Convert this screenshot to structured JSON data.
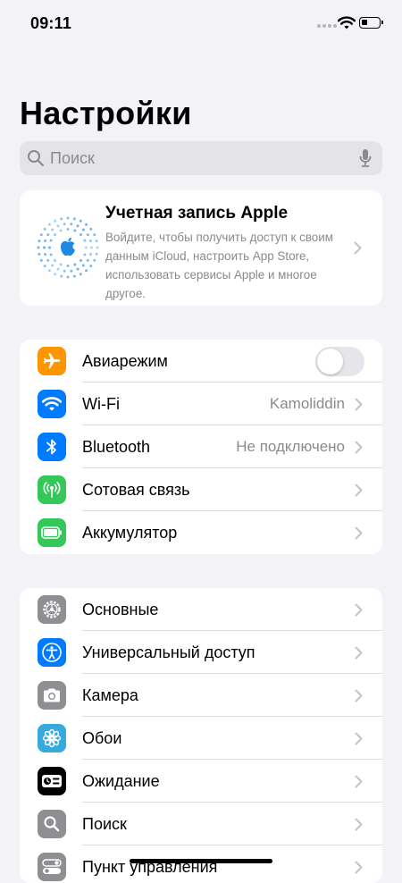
{
  "status_bar": {
    "time": "09:11",
    "battery_level_percent": 35
  },
  "header": {
    "title": "Настройки"
  },
  "search": {
    "placeholder": "Поиск"
  },
  "account": {
    "title": "Учетная запись Apple",
    "description": "Войдите, чтобы получить доступ к своим данным iCloud, настроить App Store, использовать сервисы Apple и многое другое."
  },
  "group1": [
    {
      "label": "Авиарежим",
      "icon": "airplane-icon",
      "color": "#ff9500",
      "toggle": false
    },
    {
      "label": "Wi-Fi",
      "value": "Kamoliddin",
      "icon": "wifi-icon",
      "color": "#007aff"
    },
    {
      "label": "Bluetooth",
      "value": "Не подключено",
      "icon": "bluetooth-icon",
      "color": "#007aff"
    },
    {
      "label": "Сотовая связь",
      "icon": "cellular-icon",
      "color": "#34c759"
    },
    {
      "label": "Аккумулятор",
      "icon": "battery-icon",
      "color": "#34c759"
    }
  ],
  "group2": [
    {
      "label": "Основные",
      "icon": "gear-icon",
      "color": "#8e8e93"
    },
    {
      "label": "Универсальный доступ",
      "icon": "accessibility-icon",
      "color": "#007aff"
    },
    {
      "label": "Камера",
      "icon": "camera-icon",
      "color": "#8e8e93"
    },
    {
      "label": "Обои",
      "icon": "wallpaper-icon",
      "color": "#36aadc"
    },
    {
      "label": "Ожидание",
      "icon": "standby-icon",
      "color": "#000000"
    },
    {
      "label": "Поиск",
      "icon": "search-icon",
      "color": "#8e8e93"
    },
    {
      "label": "Пункт управления",
      "icon": "control-center-icon",
      "color": "#8e8e93"
    }
  ],
  "colors": {
    "background": "#f2f2f7",
    "accent": "#007aff",
    "secondary_text": "#8a8a8e"
  }
}
